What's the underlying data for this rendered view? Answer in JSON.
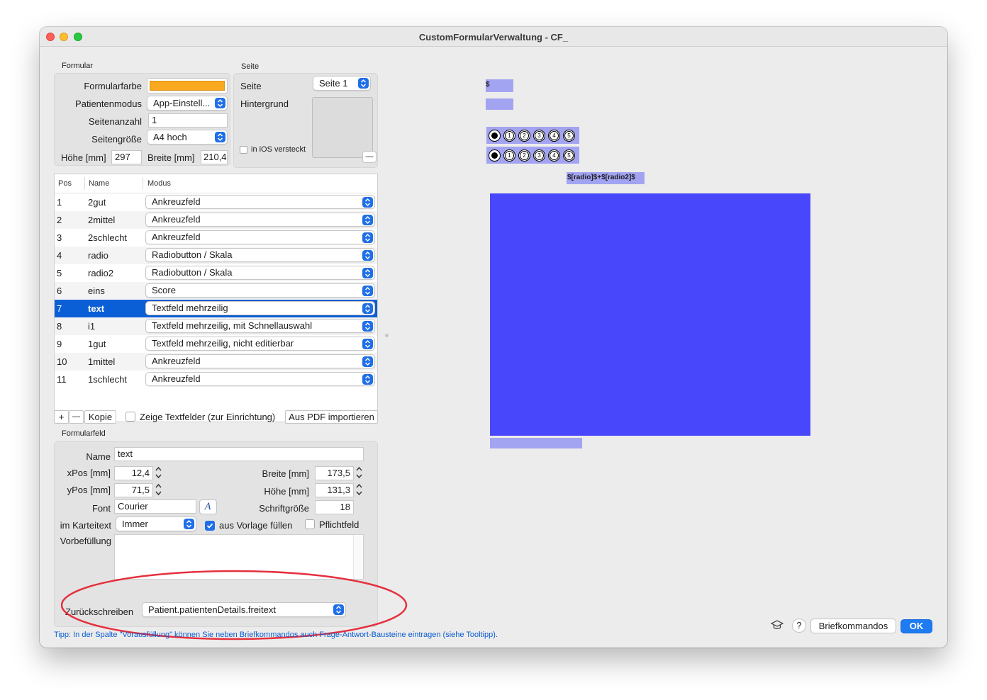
{
  "window": {
    "title": "CustomFormularVerwaltung - CF_"
  },
  "formular": {
    "section_label": "Formular",
    "formularfarbe_label": "Formularfarbe",
    "formularfarbe_color": "#f9a91f",
    "patientenmodus_label": "Patientenmodus",
    "patientenmodus_value": "App-Einstell...",
    "seitenanzahl_label": "Seitenanzahl",
    "seitenanzahl_value": "1",
    "seitengroesse_label": "Seitengröße",
    "seitengroesse_value": "A4 hoch",
    "hoehe_label": "Höhe [mm]",
    "hoehe_value": "297",
    "breite_label": "Breite [mm]",
    "breite_value": "210,4"
  },
  "seite": {
    "section_label": "Seite",
    "seite_label": "Seite",
    "seite_value": "Seite 1",
    "hintergrund_label": "Hintergrund",
    "ios_hidden_label": "in iOS versteckt",
    "remove_label": "—"
  },
  "table": {
    "headers": [
      "Pos",
      "Name",
      "Modus"
    ],
    "rows": [
      {
        "pos": "1",
        "name": "2gut",
        "modus": "Ankreuzfeld"
      },
      {
        "pos": "2",
        "name": "2mittel",
        "modus": "Ankreuzfeld"
      },
      {
        "pos": "3",
        "name": "2schlecht",
        "modus": "Ankreuzfeld"
      },
      {
        "pos": "4",
        "name": "radio",
        "modus": "Radiobutton / Skala"
      },
      {
        "pos": "5",
        "name": "radio2",
        "modus": "Radiobutton / Skala"
      },
      {
        "pos": "6",
        "name": "eins",
        "modus": "Score"
      },
      {
        "pos": "7",
        "name": "text",
        "modus": "Textfeld mehrzeilig"
      },
      {
        "pos": "8",
        "name": "i1",
        "modus": "Textfeld mehrzeilig, mit Schnellauswahl"
      },
      {
        "pos": "9",
        "name": "1gut",
        "modus": "Textfeld mehrzeilig, nicht editierbar"
      },
      {
        "pos": "10",
        "name": "1mittel",
        "modus": "Ankreuzfeld"
      },
      {
        "pos": "11",
        "name": "1schlecht",
        "modus": "Ankreuzfeld"
      }
    ],
    "selected_row": 7
  },
  "toolbar": {
    "add_label": "+",
    "remove_label": "—",
    "kopie_label": "Kopie",
    "zeige_label": "Zeige Textfelder (zur Einrichtung)",
    "import_label": "Aus PDF importieren"
  },
  "formularfeld": {
    "section_label": "Formularfeld",
    "name_label": "Name",
    "name_value": "text",
    "xpos_label": "xPos [mm]",
    "xpos_value": "12,4",
    "ypos_label": "yPos [mm]",
    "ypos_value": "71,5",
    "breite_label": "Breite [mm]",
    "breite_value": "173,5",
    "hoehe_label": "Höhe [mm]",
    "hoehe_value": "131,3",
    "font_label": "Font",
    "font_value": "Courier",
    "font_button": "A",
    "schriftgroesse_label": "Schriftgröße",
    "schriftgroesse_value": "18",
    "karteitext_label": "im Karteitext",
    "karteitext_value": "Immer",
    "vorlage_label": "aus Vorlage füllen",
    "pflicht_label": "Pflichtfeld",
    "vorbefuellung_label": "Vorbefüllung",
    "zurueck_label": "Zurückschreiben",
    "zurueck_value": "Patient.patientenDetails.freitext"
  },
  "tip": "Tipp: In der Spalte \"Vorausfüllung\" können Sie neben Briefkommandos auch Frage-Antwort-Bausteine eintragen (siehe Tooltipp).",
  "footer": {
    "help_label": "?",
    "briefkommandos_label": "Briefkommandos",
    "ok_label": "OK"
  },
  "preview": {
    "dollar_label": "$",
    "radio_nums": [
      "1",
      "2",
      "3",
      "4",
      "5"
    ],
    "formula_label": "$[radio]$+$[radio2]$",
    "field_color": "#4847fb",
    "light_color": "#a3a4f1"
  },
  "annotation": {
    "color": "#e5303e"
  }
}
